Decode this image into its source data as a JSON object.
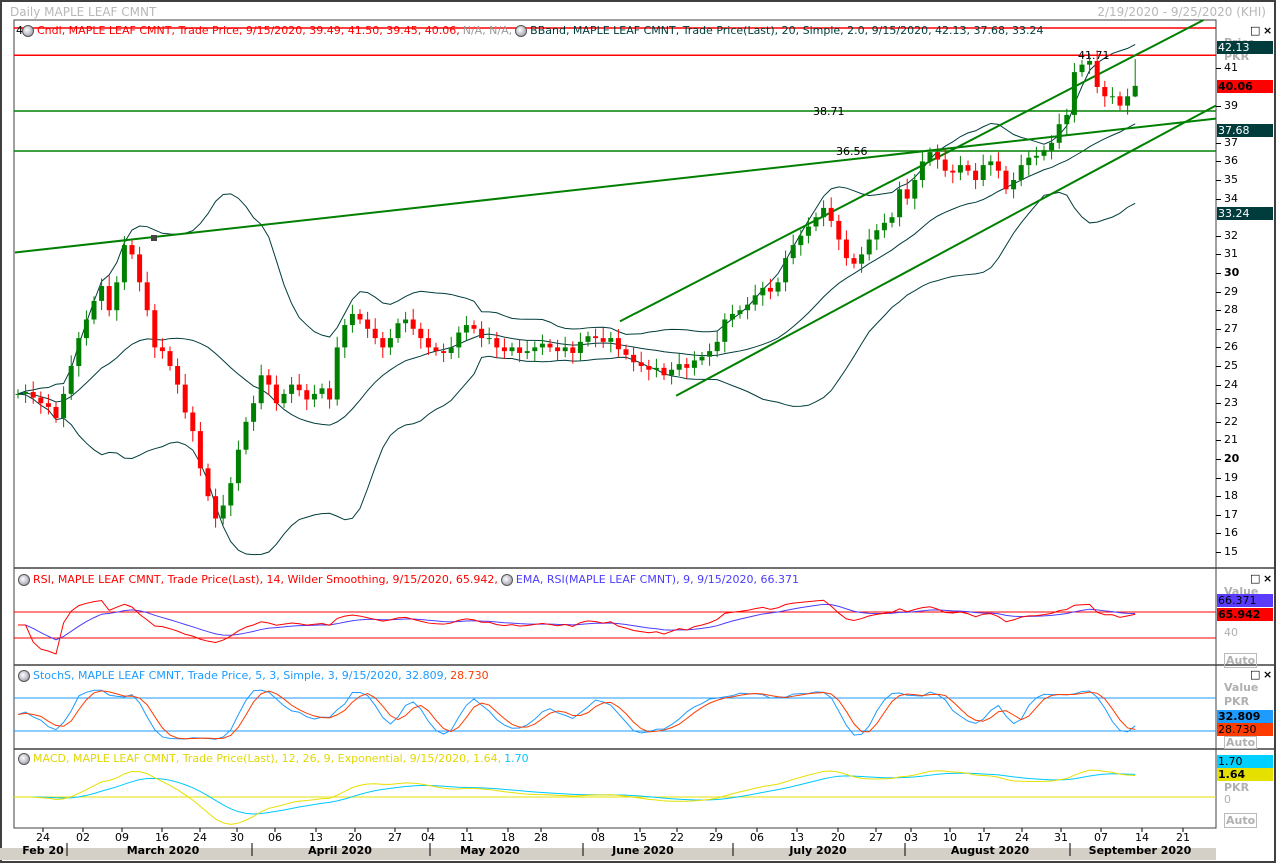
{
  "window": {
    "title": "Daily MAPLE LEAF CMNT",
    "range": "2/19/2020 - 9/25/2020 (KHI)",
    "corner_label": "4"
  },
  "legends": {
    "candle": {
      "text": "Cndl, MAPLE LEAF CMNT, Trade Price, 9/15/2020, 39.49, 41.50, 39.45, 40.06,",
      "na": "N/A, N/A,",
      "color": "#ff0000"
    },
    "bband": {
      "text": "BBand, MAPLE LEAF CMNT, Trade Price(Last),  20, Simple, 2.0, 9/15/2020, 42.13, 37.68, 33.24",
      "color": "#003c3c"
    },
    "rsi": {
      "text": "RSI, MAPLE LEAF CMNT, Trade Price(Last),  14, Wilder Smoothing, 9/15/2020, 65.942,",
      "color": "#ff0000"
    },
    "ema": {
      "text": "EMA, RSI(MAPLE LEAF CMNT),  9, 9/15/2020, 66.371",
      "color": "#4b3cff"
    },
    "stoch": {
      "text": "StochS, MAPLE LEAF CMNT, Trade Price,  5, 3, Simple, 3, 9/15/2020, 32.809,",
      "d": "28.730",
      "color": "#1e9bff"
    },
    "macd": {
      "text": "MACD, MAPLE LEAF CMNT, Trade Price(Last),  12, 26, 9, Exponential, 9/15/2020, 1.64,",
      "signal": "1.70",
      "color": "#e0d800"
    }
  },
  "price_axis": {
    "header1": "Price",
    "header2": "PKR",
    "ticks": [
      15,
      16,
      17,
      18,
      19,
      20,
      21,
      22,
      23,
      24,
      25,
      26,
      27,
      28,
      29,
      30,
      31,
      32,
      34,
      35,
      36,
      37,
      39,
      41
    ],
    "bold": [
      20,
      30
    ],
    "boxes": [
      {
        "v": 42.13,
        "label": "42.13",
        "bg": "#003c3c",
        "fg": "#ffffff"
      },
      {
        "v": 40.06,
        "label": "40.06",
        "bg": "#ff0000",
        "fg": "#000000"
      },
      {
        "v": 37.68,
        "label": "37.68",
        "bg": "#003c3c",
        "fg": "#ffffff"
      },
      {
        "v": 33.24,
        "label": "33.24",
        "bg": "#003c3c",
        "fg": "#ffffff"
      }
    ]
  },
  "rsi_axis": {
    "header": "Value",
    "tick": "40",
    "auto": "Auto",
    "boxes": [
      {
        "label": "66.371",
        "bg": "#5a3cff",
        "fg": "#000"
      },
      {
        "label": "65.942",
        "bg": "#ff0000",
        "fg": "#000"
      }
    ]
  },
  "stoch_axis": {
    "header1": "Value",
    "header2": "PKR",
    "auto": "Auto",
    "boxes": [
      {
        "label": "32.809",
        "bg": "#1e9bff",
        "fg": "#000"
      },
      {
        "label": "28.730",
        "bg": "#ff3c00",
        "fg": "#000"
      }
    ]
  },
  "macd_axis": {
    "header": "PKR",
    "tick": "0",
    "auto": "Auto",
    "boxes": [
      {
        "label": "1.70",
        "bg": "#00d0ff",
        "fg": "#000"
      },
      {
        "label": "1.64",
        "bg": "#e6e000",
        "fg": "#000"
      }
    ]
  },
  "pane_controls": {
    "maximize": "□",
    "close": "×"
  },
  "x_axis": {
    "days": [
      "24",
      "02",
      "09",
      "16",
      "24",
      "30",
      "06",
      "13",
      "20",
      "27",
      "04",
      "11",
      "18",
      "28",
      "08",
      "15",
      "22",
      "29",
      "06",
      "13",
      "20",
      "27",
      "03",
      "10",
      "17",
      "24",
      "31",
      "07",
      "14",
      "21"
    ],
    "months": [
      "Feb 20",
      "March 2020",
      "April 2020",
      "May 2020",
      "June 2020",
      "July 2020",
      "August 2020",
      "September 2020"
    ]
  },
  "chart_data": {
    "type": "candlestick",
    "title": "Daily MAPLE LEAF CMNT",
    "ylabel": "Price PKR",
    "ylim": [
      14.5,
      44
    ],
    "closes": [
      23.5,
      23.6,
      23.3,
      23.0,
      22.8,
      22.2,
      23.5,
      25,
      26.5,
      27.5,
      28.5,
      29.3,
      28,
      29.5,
      31.5,
      31,
      29.5,
      28,
      26,
      25.8,
      25,
      24,
      22.5,
      21.5,
      19.5,
      18,
      16.8,
      17.5,
      18.7,
      20.5,
      22,
      23,
      24.5,
      24,
      23,
      23.5,
      24,
      23.7,
      23.2,
      23.5,
      23.8,
      23.2,
      26,
      27.2,
      27.8,
      27.5,
      27,
      26.5,
      26,
      26.5,
      27.3,
      27.5,
      27,
      26.5,
      26,
      25.8,
      25.7,
      26,
      26.8,
      27.2,
      27,
      26.5,
      26.5,
      26,
      25.8,
      26,
      25.7,
      25.8,
      26,
      26.2,
      26,
      25.8,
      26,
      25.7,
      26.3,
      26.6,
      26.5,
      26.3,
      26.5,
      25.9,
      25.6,
      25.2,
      25,
      24.8,
      24.9,
      24.5,
      24.8,
      25.1,
      24.9,
      25.3,
      25.5,
      25.8,
      26.3,
      27.5,
      27.8,
      28,
      28.3,
      28.8,
      29.2,
      29,
      29.5,
      30.8,
      31.5,
      32,
      32.5,
      33,
      33.5,
      32.8,
      31.8,
      30.8,
      30.5,
      31,
      31.8,
      32.3,
      32.7,
      33,
      34.5,
      34,
      35,
      36,
      36.5,
      36.1,
      35.5,
      35.4,
      35.8,
      35.5,
      35,
      35.8,
      36,
      35.5,
      34.5,
      35,
      35.8,
      36.2,
      36.3,
      36.6,
      37,
      38,
      38.5,
      40.8,
      41.2,
      41.4,
      40,
      39.5,
      39.5,
      39.0,
      39.5,
      40.06
    ],
    "last_bar": {
      "date": "9/15/2020",
      "open": 39.49,
      "high": 41.5,
      "low": 39.45,
      "close": 40.06
    },
    "horizontal_lines": [
      {
        "value": 41.71,
        "label": "41.71",
        "color": "#ff0000"
      },
      {
        "value": 43.17,
        "label": "",
        "color": "#ff0000"
      },
      {
        "value": 38.71,
        "label": "38.71",
        "color": "#008000"
      },
      {
        "value": 36.56,
        "label": "36.56",
        "color": "#008000"
      }
    ],
    "trend_lines": [
      {
        "from": [
          -0.4,
          31.1
        ],
        "to": [
          157.6,
          38.3
        ]
      },
      {
        "from": [
          79.2,
          27.4
        ],
        "to": [
          156,
          43.6
        ]
      },
      {
        "from": [
          86.6,
          23.4
        ],
        "to": [
          157.6,
          39.0
        ]
      }
    ],
    "indicators": {
      "bband": {
        "period": 20,
        "dev": 2.0
      },
      "rsi": {
        "period": 14,
        "ema": 9,
        "levels": [
          30,
          70
        ]
      },
      "stoch": {
        "k": 5,
        "smooth": 3,
        "d": 3,
        "levels": [
          20,
          80
        ]
      },
      "macd": {
        "fast": 12,
        "slow": 26,
        "signal": 9
      }
    }
  }
}
